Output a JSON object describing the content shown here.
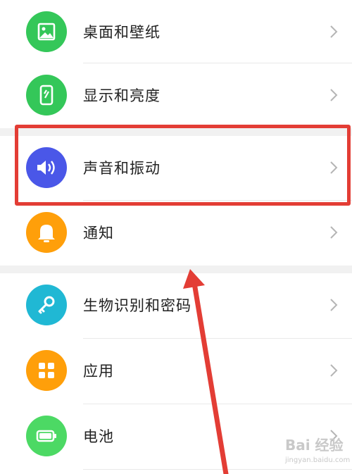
{
  "settings_items": [
    {
      "label": "桌面和壁纸",
      "icon": "wallpaper-icon",
      "color": "#34c759"
    },
    {
      "label": "显示和亮度",
      "icon": "display-brightness-icon",
      "color": "#34c759"
    },
    {
      "label": "声音和振动",
      "icon": "speaker-icon",
      "color": "#4a57e8"
    },
    {
      "label": "通知",
      "icon": "bell-icon",
      "color": "#ff9f0a"
    },
    {
      "label": "生物识别和密码",
      "icon": "key-icon",
      "color": "#20b8d4"
    },
    {
      "label": "应用",
      "icon": "apps-grid-icon",
      "color": "#ff9f0a"
    },
    {
      "label": "电池",
      "icon": "battery-icon",
      "color": "#4cd964"
    }
  ],
  "watermark": {
    "main": "Bai 经验",
    "sub": "jingyan.baidu.com"
  },
  "annotation_color": "#e33d35"
}
